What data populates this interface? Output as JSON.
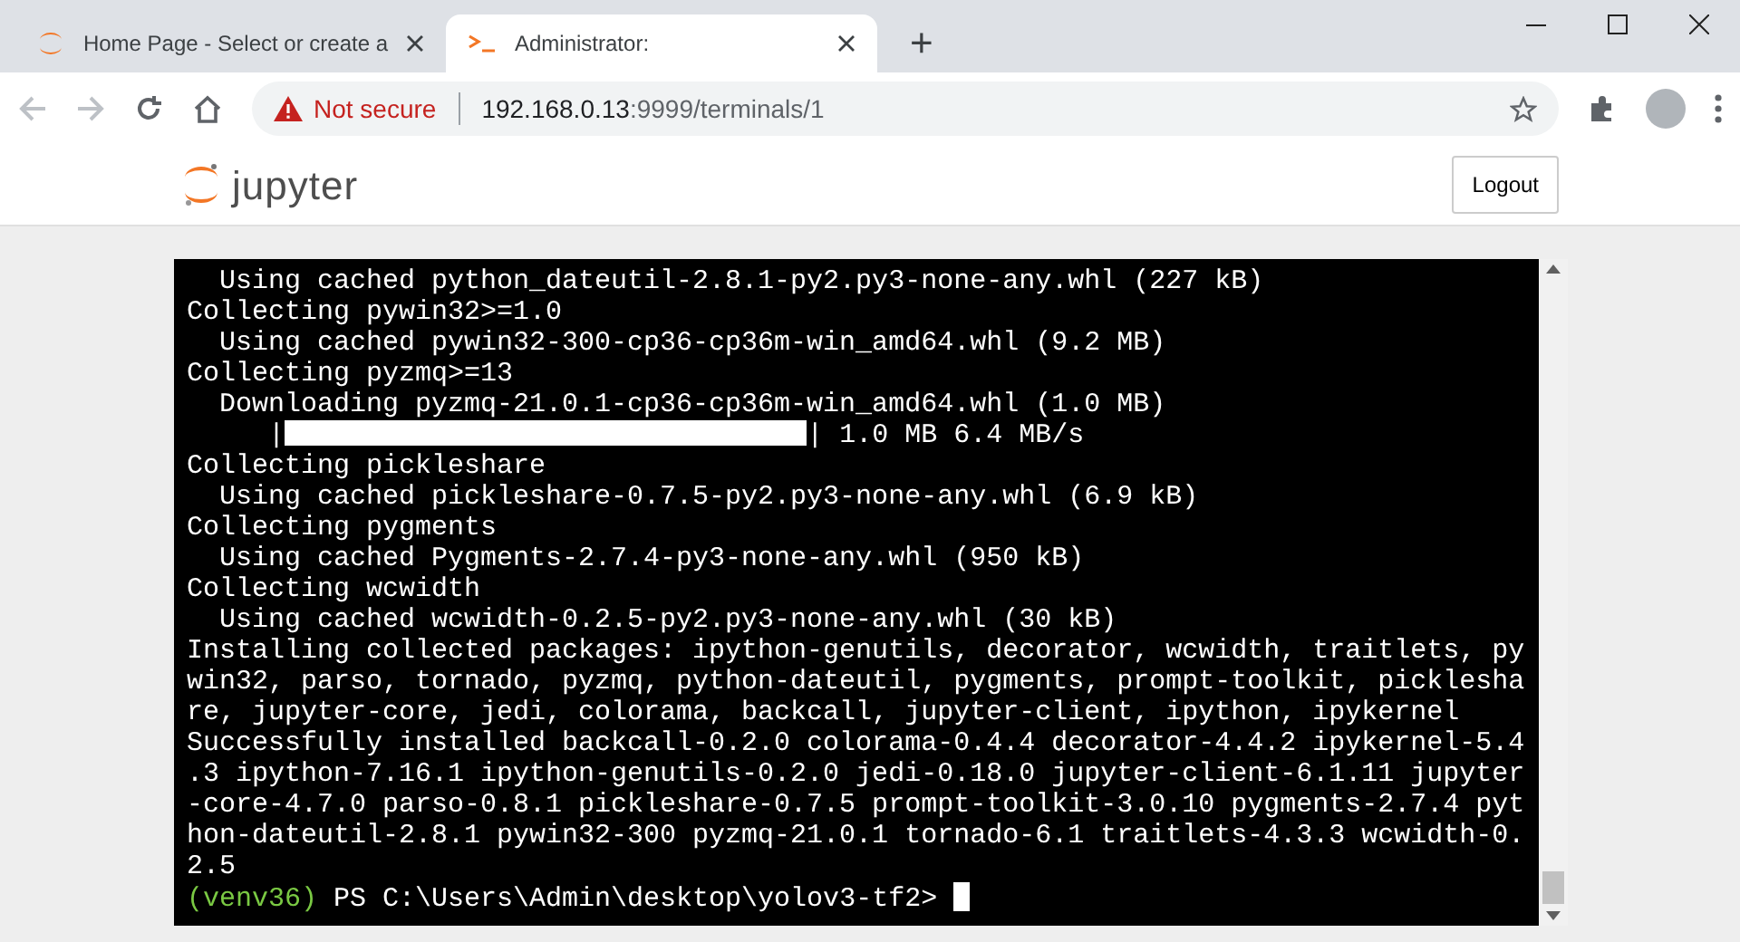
{
  "browser": {
    "tabs": [
      {
        "title": "Home Page - Select or create a",
        "kind": "jupyter",
        "selected": false
      },
      {
        "title": "Administrator:",
        "kind": "terminal",
        "selected": true
      }
    ],
    "new_tab": "+",
    "address_bar": {
      "security": "Not secure",
      "url_host": "192.168.0.13",
      "url_path": ":9999/terminals/1"
    }
  },
  "header": {
    "logo_text": "jupyter",
    "logout_button": "Logout"
  },
  "terminal": {
    "lines": [
      {
        "kind": "text",
        "text": "  Using cached python_dateutil-2.8.1-py2.py3-none-any.whl (227 kB)"
      },
      {
        "kind": "text",
        "text": "Collecting pywin32>=1.0"
      },
      {
        "kind": "text",
        "text": "  Using cached pywin32-300-cp36-cp36m-win_amd64.whl (9.2 MB)"
      },
      {
        "kind": "text",
        "text": "Collecting pyzmq>=13"
      },
      {
        "kind": "text",
        "text": "  Downloading pyzmq-21.0.1-cp36-cp36m-win_amd64.whl (1.0 MB)"
      },
      {
        "kind": "progress",
        "prefix": "     |",
        "level": 1.0,
        "suffix": "| 1.0 MB 6.4 MB/s"
      },
      {
        "kind": "text",
        "text": "Collecting pickleshare"
      },
      {
        "kind": "text",
        "text": "  Using cached pickleshare-0.7.5-py2.py3-none-any.whl (6.9 kB)"
      },
      {
        "kind": "text",
        "text": "Collecting pygments"
      },
      {
        "kind": "text",
        "text": "  Using cached Pygments-2.7.4-py3-none-any.whl (950 kB)"
      },
      {
        "kind": "text",
        "text": "Collecting wcwidth"
      },
      {
        "kind": "text",
        "text": "  Using cached wcwidth-0.2.5-py2.py3-none-any.whl (30 kB)"
      },
      {
        "kind": "text",
        "text": "Installing collected packages: ipython-genutils, decorator, wcwidth, traitlets, py"
      },
      {
        "kind": "text",
        "text": "win32, parso, tornado, pyzmq, python-dateutil, pygments, prompt-toolkit, picklesha"
      },
      {
        "kind": "text",
        "text": "re, jupyter-core, jedi, colorama, backcall, jupyter-client, ipython, ipykernel"
      },
      {
        "kind": "text",
        "text": "Successfully installed backcall-0.2.0 colorama-0.4.4 decorator-4.4.2 ipykernel-5.4"
      },
      {
        "kind": "text",
        "text": ".3 ipython-7.16.1 ipython-genutils-0.2.0 jedi-0.18.0 jupyter-client-6.1.11 jupyter"
      },
      {
        "kind": "text",
        "text": "-core-4.7.0 parso-0.8.1 pickleshare-0.7.5 prompt-toolkit-3.0.10 pygments-2.7.4 pyt"
      },
      {
        "kind": "text",
        "text": "hon-dateutil-2.8.1 pywin32-300 pyzmq-21.0.1 tornado-6.1 traitlets-4.3.3 wcwidth-0."
      },
      {
        "kind": "text",
        "text": "2.5"
      },
      {
        "kind": "prompt",
        "env": "(venv36)",
        "text": "PS C:\\Users\\Admin\\desktop\\yolov3-tf2>"
      }
    ]
  }
}
